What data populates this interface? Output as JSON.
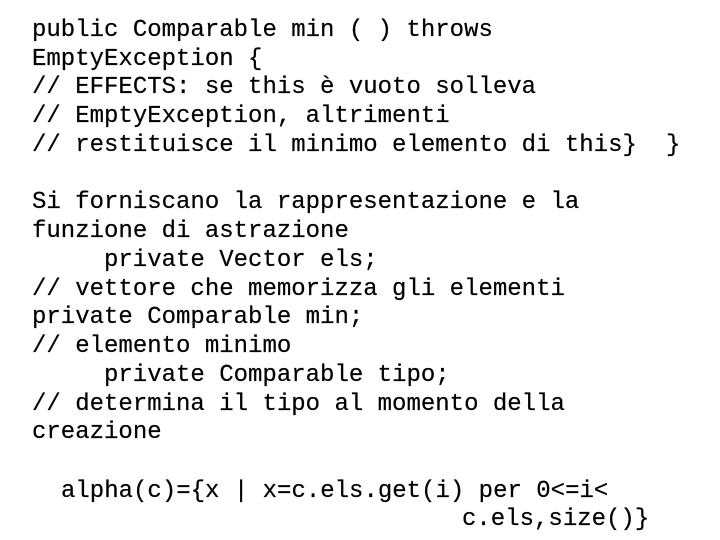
{
  "spec_block": {
    "lines": [
      "public Comparable min ( ) throws",
      "EmptyException {",
      "// EFFECTS: se this è vuoto solleva",
      "// EmptyException, altrimenti",
      "// restituisce il minimo elemento di this}"
    ],
    "trailing_brace": "}"
  },
  "question": {
    "lines": [
      "Si forniscano la rappresentazione e la",
      "funzione di astrazione"
    ]
  },
  "representation": {
    "lines": [
      "private Vector els;",
      "// vettore che memorizza gli elementi",
      "private Comparable min;",
      "// elemento minimo",
      "private Comparable tipo;",
      "// determina il tipo al momento della",
      "creazione"
    ]
  },
  "abstraction_function": {
    "line1": "alpha(c)={x | x=c.els.get(i) per 0<=i<",
    "line2": "c.els,size()}"
  }
}
